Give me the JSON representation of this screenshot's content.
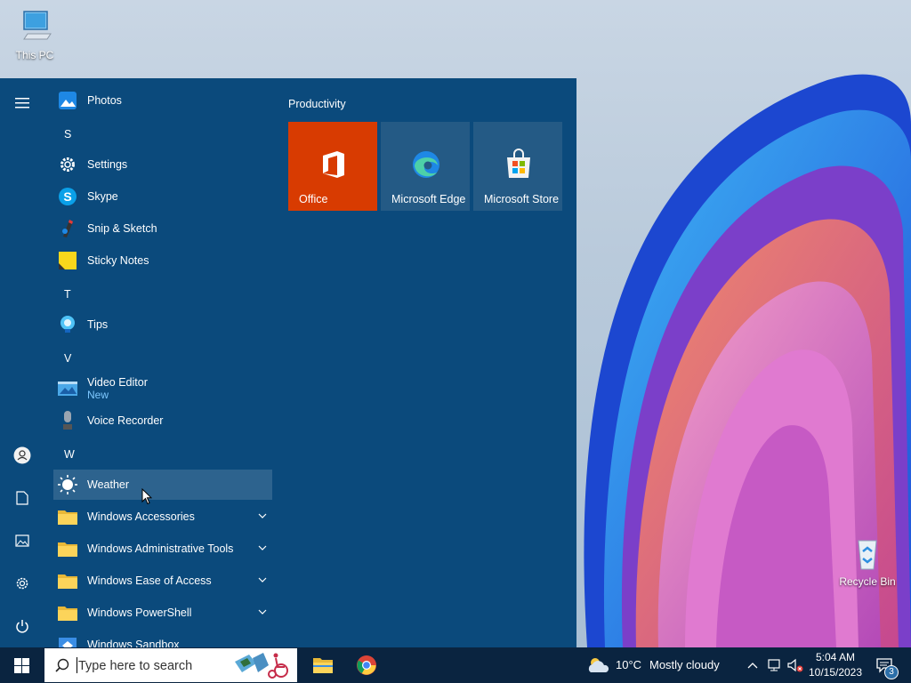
{
  "desktop": {
    "this_pc_label": "This PC",
    "recycle_bin_label": "Recycle Bin"
  },
  "start_menu": {
    "apps": [
      {
        "label": "Photos",
        "icon": "photos-icon"
      },
      {
        "label": "Settings",
        "icon": "gear-icon"
      },
      {
        "label": "Skype",
        "icon": "skype-icon"
      },
      {
        "label": "Snip & Sketch",
        "icon": "snip-sketch-icon"
      },
      {
        "label": "Sticky Notes",
        "icon": "sticky-notes-icon"
      },
      {
        "label": "Tips",
        "icon": "lightbulb-icon"
      },
      {
        "label": "Video Editor",
        "icon": "video-editor-icon",
        "badge": "New"
      },
      {
        "label": "Voice Recorder",
        "icon": "microphone-icon"
      },
      {
        "label": "Weather",
        "icon": "sun-icon"
      },
      {
        "label": "Windows Accessories",
        "icon": "folder-icon"
      },
      {
        "label": "Windows Administrative Tools",
        "icon": "folder-icon"
      },
      {
        "label": "Windows Ease of Access",
        "icon": "folder-icon"
      },
      {
        "label": "Windows PowerShell",
        "icon": "folder-icon"
      },
      {
        "label": "Windows Sandbox",
        "icon": "sandbox-icon"
      }
    ],
    "letters": [
      "S",
      "T",
      "V",
      "W"
    ],
    "tiles_group": "Productivity",
    "tiles": [
      {
        "label": "Office",
        "color": "#d83b01"
      },
      {
        "label": "Microsoft Edge",
        "color": "#245a85"
      },
      {
        "label": "Microsoft Store",
        "color": "#245a85"
      }
    ]
  },
  "taskbar": {
    "search_placeholder": "Type here to search",
    "weather_temp": "10°C",
    "weather_desc": "Mostly cloudy",
    "time": "5:04 AM",
    "date": "10/15/2023",
    "notification_count": "3"
  }
}
